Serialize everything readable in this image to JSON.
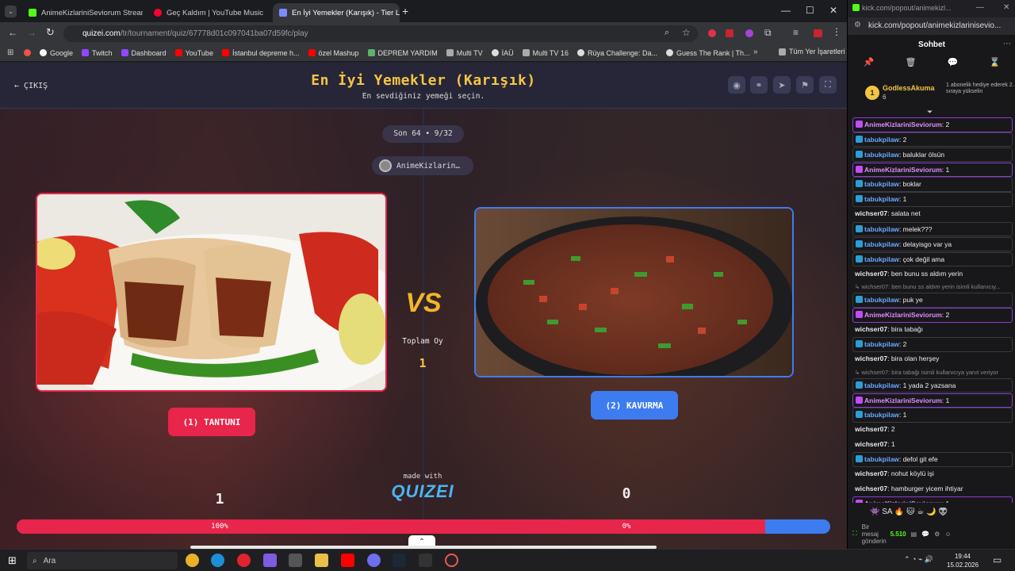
{
  "browser": {
    "tabs": [
      {
        "label": "AnimeKizlariniSeviorum Stream",
        "color": "#53fc18"
      },
      {
        "label": "Geç Kaldım | YouTube Music",
        "color": "#ff0033"
      },
      {
        "label": "En İyi Yemekler (Karışık) - Tier L",
        "color": "#7c8cff"
      }
    ],
    "url_host": "quizei.com",
    "url_path": "/tr/tournament/quiz/67778d01c097041ba07d59fc/play",
    "bookmarks": [
      "Google",
      "Twitch",
      "Dashboard",
      "YouTube",
      "İstanbul depreme h...",
      "özel Mashup",
      "DEPREM YARDIM",
      "Multi TV",
      "İAÜ",
      "Multi TV 16",
      "Rüya Challenge: Da...",
      "Guess The Rank | Th...",
      "Tüm Yer İşaretleri"
    ]
  },
  "quiz": {
    "exit_label": "ÇIKIŞ",
    "title": "En İyi Yemekler (Karışık)",
    "subtitle": "En sevdiğiniz yemeği seçin.",
    "round": "Son 64 • 9/32",
    "username": "AnimeKizlarin…",
    "left_option": "(1) TANTUNI",
    "right_option": "(2) KAVURMA",
    "vs": "VS",
    "total_label": "Toplam Oy",
    "total_value": "1",
    "left_count": "1",
    "right_count": "0",
    "made_with": "made with",
    "logo": "QUIZEI",
    "left_percent_label": "100%",
    "right_percent_label": "0%",
    "left_share": 0.92
  },
  "popout": {
    "title": "kick.com/popout/animekizl...",
    "url": "kick.com/popout/animekizlarinisevio...",
    "header": "Sohbet",
    "pinned_user": "GodlessAkuma",
    "pinned_sub": "6",
    "pinned_text": "1 abonelik hediye ederek 2. sıraya yükselin",
    "input_placeholder": "Bir mesaj gönderin",
    "points": "5.510",
    "messages": [
      {
        "user": "AnimeKizlariniSeviorum",
        "text": ": 2",
        "type": "hl",
        "color": "#e28cff"
      },
      {
        "user": "tabukpilaw",
        "text": ": 2",
        "type": "boxed",
        "color": "#69a7ff"
      },
      {
        "user": "tabukpilaw",
        "text": ": baluklar ölsün",
        "type": "boxed",
        "color": "#69a7ff"
      },
      {
        "user": "AnimeKizlariniSeviorum",
        "text": ": 1",
        "type": "hl",
        "color": "#e28cff"
      },
      {
        "user": "tabukpilaw",
        "text": ": boklar",
        "type": "boxed",
        "color": "#69a7ff"
      },
      {
        "user": "tabukpilaw",
        "text": ": 1",
        "type": "boxed",
        "color": "#69a7ff"
      },
      {
        "user": "wichser07",
        "text": ": salata net",
        "type": "plain",
        "color": "#e8e8e8"
      },
      {
        "user": "tabukpilaw",
        "text": ": melek???",
        "type": "boxed",
        "color": "#69a7ff"
      },
      {
        "user": "tabukpilaw",
        "text": ": delayisgo var ya",
        "type": "boxed",
        "color": "#69a7ff"
      },
      {
        "user": "tabukpilaw",
        "text": ": çok değil ama",
        "type": "boxed",
        "color": "#69a7ff"
      },
      {
        "user": "wichser07",
        "text": ": ben bunu ss aldım yerin",
        "type": "plain",
        "color": "#e8e8e8"
      },
      {
        "user": "",
        "text": "↳ wichser07: ben bunu ss aldım yerin isimli kullanıcıy...",
        "type": "reply",
        "color": "#888"
      },
      {
        "user": "tabukpilaw",
        "text": ": puk ye",
        "type": "boxed",
        "color": "#69a7ff"
      },
      {
        "user": "AnimeKizlariniSeviorum",
        "text": ": 2",
        "type": "hl",
        "color": "#e28cff"
      },
      {
        "user": "wichser07",
        "text": ": bira tabağı",
        "type": "plain",
        "color": "#e8e8e8"
      },
      {
        "user": "tabukpilaw",
        "text": ": 2",
        "type": "boxed",
        "color": "#69a7ff"
      },
      {
        "user": "wichser07",
        "text": ": bira olan herşey",
        "type": "plain",
        "color": "#e8e8e8"
      },
      {
        "user": "",
        "text": "↳ wichser07: bira tabağı isimli kullanıcıya yanıt veriyor",
        "type": "reply",
        "color": "#888"
      },
      {
        "user": "tabukpilaw",
        "text": ": 1 yada 2 yazsana",
        "type": "boxed",
        "color": "#69a7ff"
      },
      {
        "user": "AnimeKizlariniSeviorum",
        "text": ": 1",
        "type": "hl",
        "color": "#e28cff"
      },
      {
        "user": "tabukpilaw",
        "text": ": 1",
        "type": "boxed",
        "color": "#69a7ff"
      },
      {
        "user": "wichser07",
        "text": ": 2",
        "type": "plain",
        "color": "#e8e8e8"
      },
      {
        "user": "wichser07",
        "text": ": 1",
        "type": "plain",
        "color": "#e8e8e8"
      },
      {
        "user": "tabukpilaw",
        "text": ": defol git efe",
        "type": "boxed",
        "color": "#69a7ff"
      },
      {
        "user": "wichser07",
        "text": ": nohut köylü işi",
        "type": "plain",
        "color": "#e8e8e8"
      },
      {
        "user": "wichser07",
        "text": ": hamburger yicem ihtiyar",
        "type": "plain",
        "color": "#e8e8e8"
      },
      {
        "user": "AnimeKizlariniSeviorum",
        "text": ": 1",
        "type": "hl",
        "color": "#e28cff"
      }
    ]
  },
  "taskbar": {
    "search_placeholder": "Ara",
    "time": "19:44",
    "date": "15.02.2026"
  },
  "colors": {
    "accent_red": "#e8254a",
    "accent_blue": "#3d7cf0",
    "title_gold": "#f5c542"
  }
}
